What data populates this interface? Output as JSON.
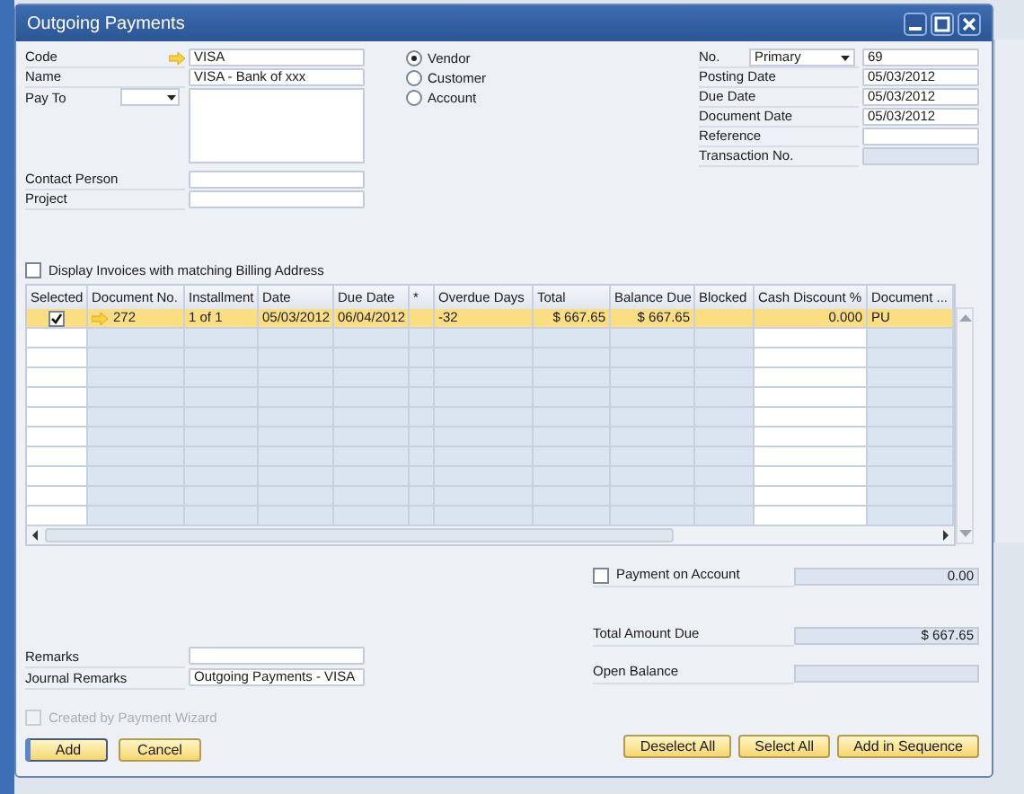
{
  "window": {
    "title": "Outgoing Payments"
  },
  "left_fields": [
    {
      "label": "Code",
      "kind": "link",
      "value": "VISA"
    },
    {
      "label": "Name",
      "kind": "text",
      "value": "VISA - Bank of xxx"
    },
    {
      "label": "Pay To",
      "kind": "address"
    },
    {
      "label": "Contact Person",
      "kind": "text"
    },
    {
      "label": "Project",
      "kind": "text"
    }
  ],
  "radios": [
    {
      "label": "Vendor",
      "selected": true
    },
    {
      "label": "Customer",
      "selected": false
    },
    {
      "label": "Account",
      "selected": false
    }
  ],
  "right_fields": [
    {
      "label": "No.",
      "kind": "series",
      "series": "Primary",
      "value": "69"
    },
    {
      "label": "Posting Date",
      "kind": "text",
      "value": "05/03/2012"
    },
    {
      "label": "Due Date",
      "kind": "text",
      "value": "05/03/2012"
    },
    {
      "label": "Document Date",
      "kind": "text",
      "value": "05/03/2012"
    },
    {
      "label": "Reference",
      "kind": "text"
    },
    {
      "label": "Transaction No.",
      "kind": "readonly"
    }
  ],
  "billing_checkbox": {
    "label": "Display Invoices with matching Billing Address",
    "checked": false
  },
  "table": {
    "columns": [
      {
        "label": "Selected",
        "kind": "check"
      },
      {
        "label": "Document No.",
        "kind": "link"
      },
      {
        "label": "Installment",
        "kind": "text"
      },
      {
        "label": "Date",
        "kind": "text"
      },
      {
        "label": "Due Date",
        "kind": "text"
      },
      {
        "label": "*",
        "kind": "text"
      },
      {
        "label": "Overdue Days",
        "kind": "text"
      },
      {
        "label": "Total",
        "kind": "amount"
      },
      {
        "label": "Balance Due",
        "kind": "amount"
      },
      {
        "label": "Blocked",
        "kind": "text"
      },
      {
        "label": "Cash Discount %",
        "kind": "input"
      },
      {
        "label": "Document ...",
        "kind": "text"
      }
    ],
    "rows": [
      {
        "selected": true,
        "checked": true,
        "cells": [
          "",
          "272",
          "1 of 1",
          "05/03/2012",
          "06/04/2012",
          "",
          "-32",
          "$ 667.65",
          "$ 667.65",
          "",
          "0.000",
          "PU"
        ]
      }
    ]
  },
  "payment_on_account": {
    "label": "Payment on Account",
    "checked": false,
    "value": "0.00"
  },
  "totals": [
    {
      "label": "Total Amount Due",
      "value": "$ 667.65"
    },
    {
      "label": "Open Balance"
    }
  ],
  "remarks": [
    {
      "label": "Remarks"
    },
    {
      "label": "Journal Remarks",
      "value": "Outgoing Payments - VISA"
    }
  ],
  "wizard_checkbox": {
    "label": "Created by Payment Wizard",
    "checked": false,
    "disabled": true
  },
  "left_buttons": [
    {
      "label": "Add",
      "default": true
    },
    {
      "label": "Cancel",
      "default": false
    }
  ],
  "right_buttons": [
    {
      "label": "Deselect All"
    },
    {
      "label": "Select All"
    },
    {
      "label": "Add in Sequence"
    }
  ]
}
